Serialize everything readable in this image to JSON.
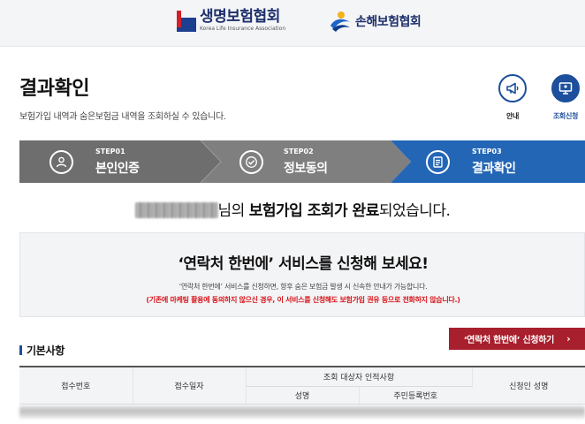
{
  "header": {
    "life_logo_kr": "생명보험협회",
    "life_logo_en": "Korea Life Insurance Association",
    "damage_logo_kr": "손해보험협회"
  },
  "page": {
    "title": "결과확인",
    "description": "보험가입 내역과 숨은보험금 내역을 조회하실 수 있습니다."
  },
  "quick": [
    {
      "label": "안내",
      "icon": "megaphone-icon"
    },
    {
      "label": "조회신청",
      "icon": "monitor-icon"
    }
  ],
  "steps": [
    {
      "no": "STEP01",
      "name": "본인인증",
      "icon": "person-icon",
      "active": false
    },
    {
      "no": "STEP02",
      "name": "정보동의",
      "icon": "check-icon",
      "active": false
    },
    {
      "no": "STEP03",
      "name": "결과확인",
      "icon": "document-icon",
      "active": true
    }
  ],
  "result": {
    "suffix_1": "님의 ",
    "bold": "보험가입 조회가 완료",
    "suffix_2": "되었습니다."
  },
  "promo": {
    "headline": "‘연락처 한번에’ 서비스를 신청해 보세요!",
    "sub": "‘연락처 한번에’ 서비스를 신청하면, 향후 숨은 보험금 발생 시 신속한 안내가 가능합니다.",
    "warning": "(기존에 마케팅 활용에 동의하지 않으신 경우, 이 서비스를 신청해도 보험가입 권유 등으로 전화하지 않습니다.)"
  },
  "section": {
    "title": "기본사항",
    "apply_button": "‘연락처 한번에’ 신청하기",
    "apply_arrow": "›"
  },
  "table": {
    "col_receipt_no": "접수번호",
    "col_receipt_date": "접수일자",
    "col_target_group": "조회 대상자 인적사항",
    "col_name": "성명",
    "col_rrn": "주민등록번호",
    "col_applicant": "신청인 성명"
  },
  "colors": {
    "step_inactive_1": "#6b6b6b",
    "step_inactive_2": "#7c7c7c",
    "step_active": "#2466b6",
    "brand_blue": "#1d4f9c",
    "apply_red": "#a81f2d",
    "warning_red": "#d9141b"
  }
}
